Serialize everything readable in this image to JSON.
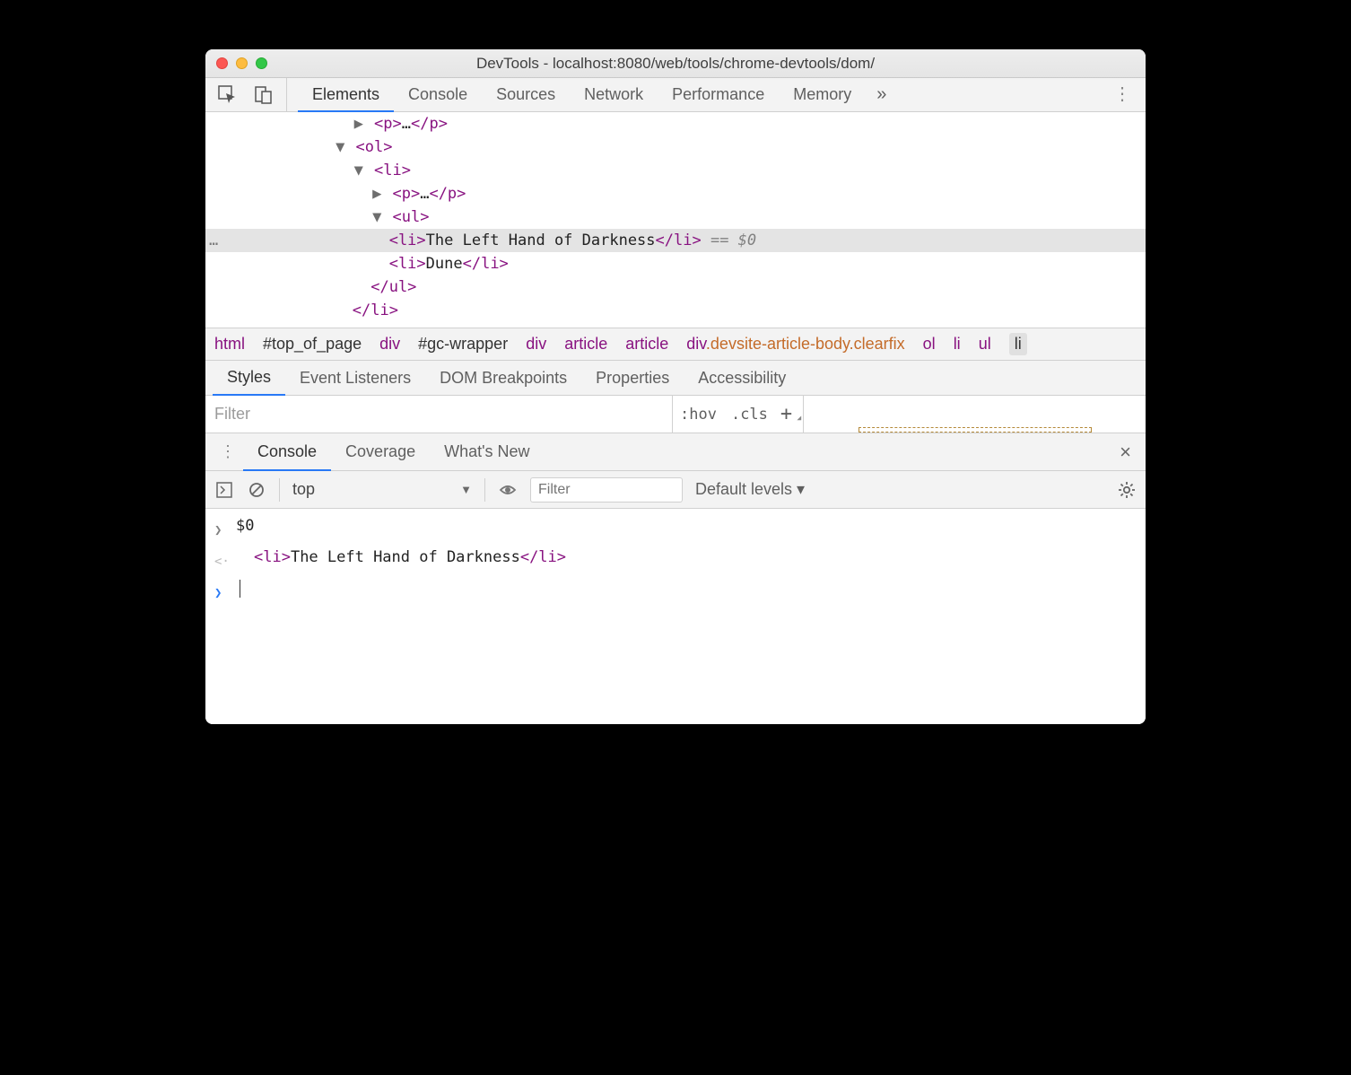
{
  "window": {
    "title": "DevTools - localhost:8080/web/tools/chrome-devtools/dom/"
  },
  "main_tabs": [
    "Elements",
    "Console",
    "Sources",
    "Network",
    "Performance",
    "Memory"
  ],
  "more_glyph": "»",
  "dom": {
    "rows": [
      {
        "indent": "                ",
        "tri": "▶",
        "open": "<p>",
        "mid": "…",
        "close": "</p>"
      },
      {
        "indent": "              ",
        "tri": "▼",
        "open": "<ol>"
      },
      {
        "indent": "                ",
        "tri": "▼",
        "open": "<li>"
      },
      {
        "indent": "                  ",
        "tri": "▶",
        "open": "<p>",
        "mid": "…",
        "close": "</p>"
      },
      {
        "indent": "                  ",
        "tri": "▼",
        "open": "<ul>"
      },
      {
        "indent": "                    ",
        "open": "<li>",
        "text": "The Left Hand of Darkness",
        "close": "</li>",
        "suffix": " == $0",
        "selected": true
      },
      {
        "indent": "                    ",
        "open": "<li>",
        "text": "Dune",
        "close": "</li>"
      },
      {
        "indent": "                  ",
        "close": "</ul>"
      },
      {
        "indent": "                ",
        "close": "</li>"
      }
    ]
  },
  "breadcrumbs": [
    {
      "t": "html",
      "k": "tag"
    },
    {
      "t": "#top_of_page",
      "k": "id"
    },
    {
      "t": "div",
      "k": "tag"
    },
    {
      "t": "#gc-wrapper",
      "k": "id"
    },
    {
      "t": "div",
      "k": "tag"
    },
    {
      "t": "article",
      "k": "tag"
    },
    {
      "t": "article",
      "k": "tag"
    },
    {
      "t": "div",
      "cls": ".devsite-article-body.clearfix",
      "k": "cls"
    },
    {
      "t": "ol",
      "k": "tag"
    },
    {
      "t": "li",
      "k": "tag"
    },
    {
      "t": "ul",
      "k": "tag"
    },
    {
      "t": "li",
      "k": "last"
    }
  ],
  "style_tabs": [
    "Styles",
    "Event Listeners",
    "DOM Breakpoints",
    "Properties",
    "Accessibility"
  ],
  "filter": {
    "placeholder": "Filter",
    "hov": ":hov",
    "cls": ".cls",
    "plus": "+"
  },
  "console_tabs": [
    "Console",
    "Coverage",
    "What's New"
  ],
  "console_toolbar": {
    "context": "top",
    "filter_placeholder": "Filter",
    "levels": "Default levels ▾"
  },
  "console_body": {
    "input": "$0",
    "result_open": "<li>",
    "result_text": "The Left Hand of Darkness",
    "result_close": "</li>"
  }
}
